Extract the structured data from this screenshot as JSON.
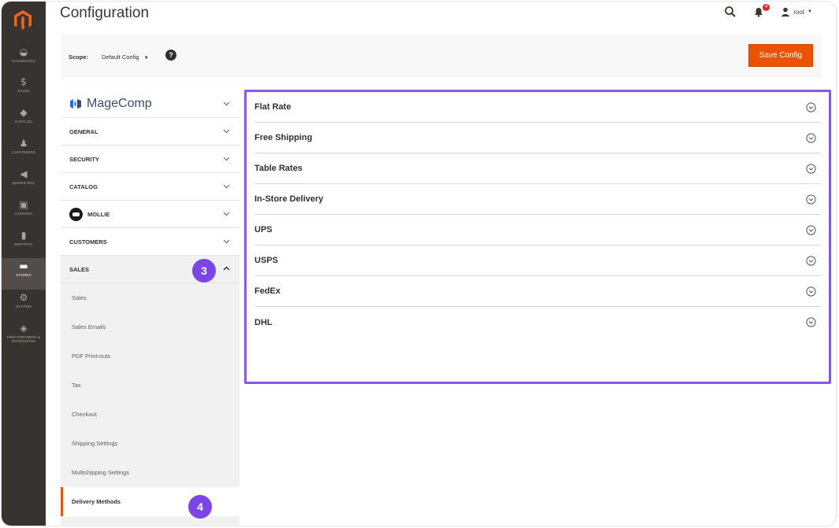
{
  "page": {
    "title": "Configuration"
  },
  "header": {
    "notifications_count": "4",
    "user_name": "root"
  },
  "nav": {
    "items": [
      {
        "label": "Dashboard",
        "icon": "dashboard-icon"
      },
      {
        "label": "Sales",
        "icon": "dollar-icon"
      },
      {
        "label": "Catalog",
        "icon": "catalog-icon"
      },
      {
        "label": "Customers",
        "icon": "customers-icon"
      },
      {
        "label": "Marketing",
        "icon": "megaphone-icon"
      },
      {
        "label": "Content",
        "icon": "content-icon"
      },
      {
        "label": "Reports",
        "icon": "reports-icon"
      },
      {
        "label": "Stores",
        "icon": "stores-icon",
        "active": true
      },
      {
        "label": "System",
        "icon": "gear-icon"
      },
      {
        "label": "Find Partners & Extensions",
        "icon": "extensions-icon"
      }
    ]
  },
  "scope": {
    "label": "Scope:",
    "value": "Default Config",
    "help": "?"
  },
  "actions": {
    "save_label": "Save Config"
  },
  "tabs": {
    "brand": "MageComp",
    "general": "GENERAL",
    "security": "SECURITY",
    "catalog": "CATALOG",
    "mollie": "MOLLIE",
    "customers": "CUSTOMERS",
    "sales": "SALES",
    "sales_items": [
      "Sales",
      "Sales Emails",
      "PDF Print-outs",
      "Tax",
      "Checkout",
      "Shipping Settings",
      "Multishipping Settings",
      "Delivery Methods"
    ]
  },
  "badges": {
    "step3": "3",
    "step4": "4"
  },
  "sections": [
    "Flat Rate",
    "Free Shipping",
    "Table Rates",
    "In-Store Delivery",
    "UPS",
    "USPS",
    "FedEx",
    "DHL"
  ],
  "colors": {
    "accent": "#eb5202",
    "highlight": "#8a55e8",
    "badge": "#7b45e8",
    "nav_bg": "#373330"
  }
}
